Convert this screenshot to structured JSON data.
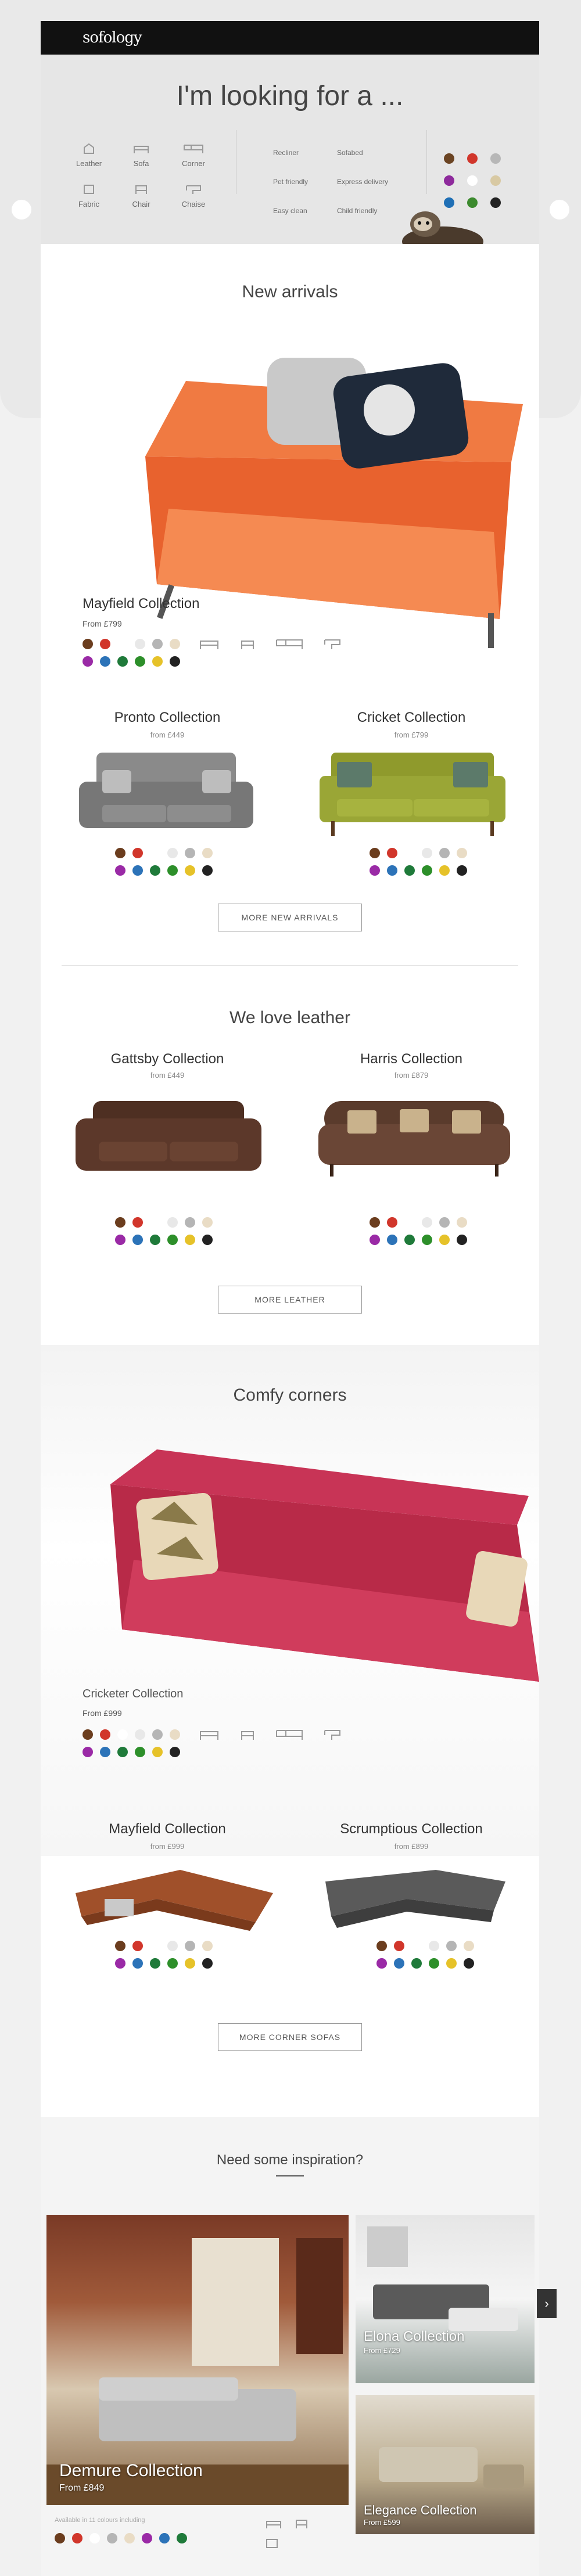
{
  "brand": {
    "logo_text": "sofology"
  },
  "finder": {
    "title": "I'm looking for a ...",
    "types": [
      {
        "label": "Leather",
        "icon": "leather-icon"
      },
      {
        "label": "Sofa",
        "icon": "sofa-icon"
      },
      {
        "label": "Corner",
        "icon": "corner-sofa-icon"
      },
      {
        "label": "Fabric",
        "icon": "fabric-icon"
      },
      {
        "label": "Chair",
        "icon": "chair-icon"
      },
      {
        "label": "Chaise",
        "icon": "chaise-icon"
      }
    ],
    "features": [
      "Recliner",
      "Sofabed",
      "Pet friendly",
      "Express delivery",
      "Easy clean",
      "Child friendly"
    ],
    "colors": [
      "#6b4423",
      "#d1362b",
      "#b7b7b7",
      "#8e2a9c",
      "#ffffff",
      "#d8c9a3",
      "#1f6fb5",
      "#3c8a2e",
      "#222222"
    ]
  },
  "new_arrivals": {
    "title": "New arrivals",
    "featured": {
      "name": "Mayfield Collection",
      "price": "From £799"
    },
    "products": [
      {
        "name": "Pronto Collection",
        "price": "from £449"
      },
      {
        "name": "Cricket Collection",
        "price": "from £799"
      }
    ],
    "button": "MORE NEW ARRIVALS"
  },
  "leather": {
    "title": "We love leather",
    "products": [
      {
        "name": "Gattsby Collection",
        "price": "from £449"
      },
      {
        "name": "Harris Collection",
        "price": "from £879"
      }
    ],
    "button": "MORE LEATHER"
  },
  "corners": {
    "title": "Comfy corners",
    "featured": {
      "name": "Cricketer Collection",
      "price": "From £999"
    },
    "products": [
      {
        "name": "Mayfield Collection",
        "price": "from £999"
      },
      {
        "name": "Scrumptious Collection",
        "price": "from £899"
      }
    ],
    "button": "MORE CORNER SOFAS"
  },
  "inspiration": {
    "title": "Need some inspiration?",
    "main": {
      "name": "Demure Collection",
      "price": "From £849",
      "note": "Available in 11 colours including"
    },
    "side": [
      {
        "name": "Elona Collection",
        "price": "From £729"
      },
      {
        "name": "Elegance Collection",
        "price": "From £599"
      }
    ]
  },
  "swatch_colors": [
    "#6b3d1e",
    "#d1362b",
    "#ffffff",
    "#e8e8e8",
    "#b5b5b5",
    "#e9dcc5",
    "#9a2aa6",
    "#2c73b8",
    "#1f7a3a",
    "#2d8f2a",
    "#e6c229",
    "#222222"
  ]
}
